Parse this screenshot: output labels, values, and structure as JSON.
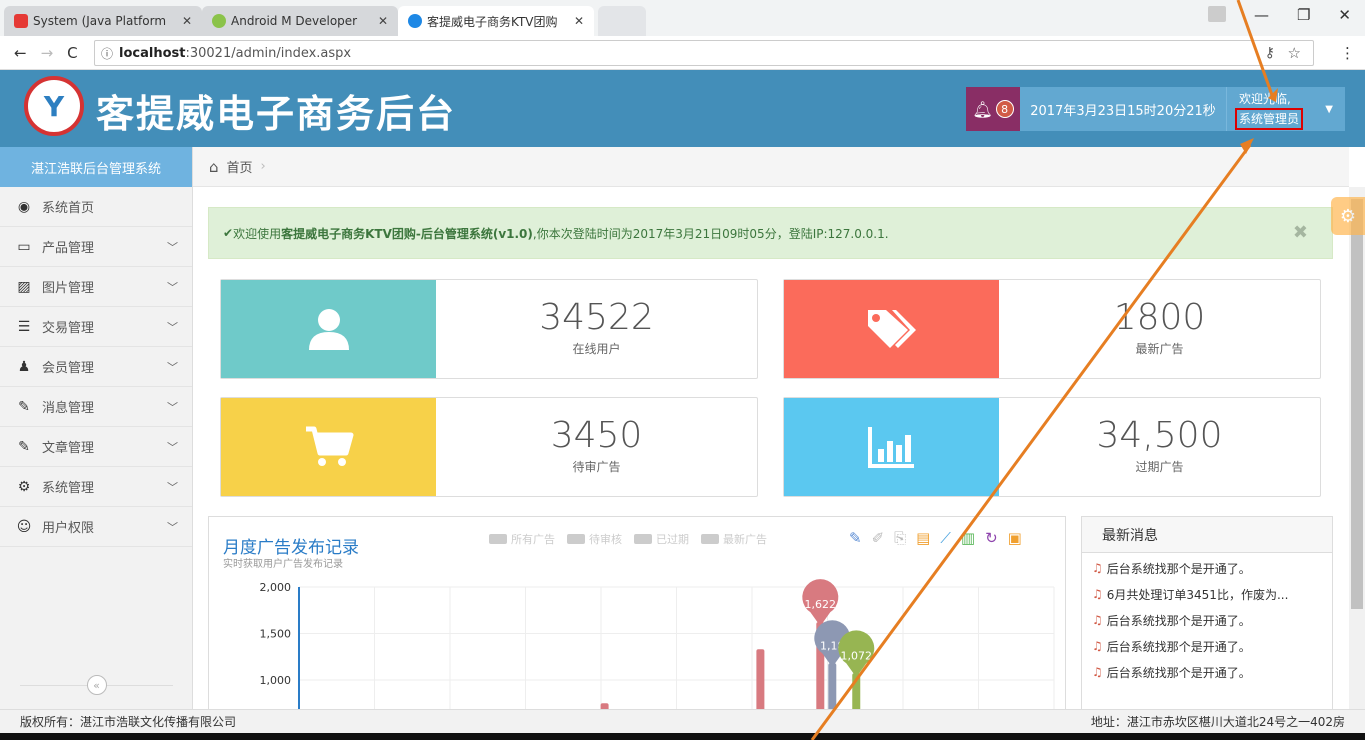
{
  "browser": {
    "tabs": [
      {
        "label": "System (Java Platform",
        "color": "#e53935"
      },
      {
        "label": "Android M Developer",
        "color": "#8bc34a"
      },
      {
        "label": "客提威电子商务KTV团购",
        "color": "#1e88e5"
      }
    ],
    "url_host": "localhost",
    "url_rest": ":30021/admin/index.aspx",
    "controls": {
      "min": "—",
      "max": "❐",
      "close": "✕"
    }
  },
  "header": {
    "title": "客提威电子商务后台",
    "notification_count": "8",
    "datetime": "2017年3月23日15时20分21秒",
    "welcome": "欢迎光临,",
    "user_role": "系统管理员"
  },
  "sidebar": {
    "heading": "湛江浩联后台管理系统",
    "items": [
      {
        "label": "系统首页",
        "icon": "dashboard-icon",
        "glyph": "◉",
        "chevron": false
      },
      {
        "label": "产品管理",
        "icon": "monitor-icon",
        "glyph": "▭",
        "chevron": true
      },
      {
        "label": "图片管理",
        "icon": "picture-icon",
        "glyph": "▨",
        "chevron": true
      },
      {
        "label": "交易管理",
        "icon": "list-icon",
        "glyph": "☰",
        "chevron": true
      },
      {
        "label": "会员管理",
        "icon": "user-icon",
        "glyph": "♟",
        "chevron": true
      },
      {
        "label": "消息管理",
        "icon": "edit-icon",
        "glyph": "✎",
        "chevron": true
      },
      {
        "label": "文章管理",
        "icon": "edit-icon",
        "glyph": "✎",
        "chevron": true
      },
      {
        "label": "系统管理",
        "icon": "cogs-icon",
        "glyph": "⚙",
        "chevron": true
      },
      {
        "label": "用户权限",
        "icon": "users-icon",
        "glyph": "☺",
        "chevron": true
      }
    ],
    "collapse_glyph": "«"
  },
  "breadcrumb": {
    "home_label": "首页",
    "sep": "›"
  },
  "alert": {
    "check": "✔",
    "prefix": "欢迎使用",
    "strong": "客提威电子商务KTV团购-后台管理系统(v1.0)",
    "suffix": ",你本次登陆时间为2017年3月21日09时05分，登陆IP:127.0.0.1.",
    "close": "✖"
  },
  "stats": [
    {
      "value": "34522",
      "label": "在线用户",
      "color": "#6fcac9",
      "icon": "user-icon"
    },
    {
      "value": "1800",
      "label": "最新广告",
      "color": "#fb6b5b",
      "icon": "tags-icon"
    },
    {
      "value": "3450",
      "label": "待审广告",
      "color": "#f7d149",
      "icon": "cart-icon"
    },
    {
      "value": "34,500",
      "label": "过期广告",
      "color": "#5bc8f0",
      "icon": "bar-chart-icon"
    }
  ],
  "chart_data": {
    "type": "bar",
    "title": "月度广告发布记录",
    "subtitle": "实时获取用户广告发布记录",
    "legend": [
      "所有广告",
      "待审核",
      "已过期",
      "最新广告"
    ],
    "ylim": [
      0,
      2000
    ],
    "yticks": [
      2000,
      1500,
      1000
    ],
    "ytick_labels": [
      "2,000",
      "1,500",
      "1,000"
    ],
    "series": [
      {
        "name": "所有广告",
        "color": "#d87a80",
        "values": [
          0,
          0,
          0,
          0,
          0,
          0,
          0,
          0,
          0,
          0,
          0,
          0,
          0,
          0,
          0,
          0,
          0,
          0,
          0,
          0,
          0,
          0,
          0,
          0,
          0,
          750,
          0,
          0,
          0,
          0,
          0,
          0,
          0,
          0,
          0,
          0,
          0,
          0,
          1330,
          0,
          0,
          0,
          0,
          1622,
          0,
          0,
          0,
          0,
          0,
          0,
          0,
          0,
          0,
          0,
          0,
          0,
          0,
          0,
          0,
          0,
          0,
          0,
          0
        ]
      },
      {
        "name": "待审核",
        "color": "#8d98b3",
        "values": [
          0,
          0,
          0,
          0,
          0,
          0,
          0,
          0,
          0,
          0,
          0,
          0,
          0,
          0,
          0,
          0,
          0,
          0,
          0,
          0,
          0,
          0,
          0,
          0,
          0,
          0,
          0,
          0,
          0,
          0,
          0,
          0,
          0,
          0,
          0,
          0,
          0,
          0,
          0,
          0,
          0,
          0,
          0,
          0,
          1180,
          0,
          0,
          0,
          0,
          0,
          0,
          0,
          0,
          0,
          0,
          0,
          0,
          0,
          0,
          0,
          0,
          0,
          0
        ]
      },
      {
        "name": "最新广告",
        "color": "#97b552",
        "values": [
          0,
          0,
          0,
          0,
          0,
          0,
          0,
          0,
          0,
          0,
          0,
          0,
          0,
          0,
          0,
          0,
          0,
          0,
          0,
          0,
          0,
          0,
          0,
          0,
          0,
          0,
          0,
          0,
          0,
          0,
          0,
          0,
          0,
          0,
          0,
          0,
          0,
          0,
          0,
          0,
          0,
          0,
          0,
          0,
          0,
          0,
          1072,
          0,
          0,
          0,
          0,
          0,
          0,
          0,
          0,
          0,
          0,
          0,
          0,
          0,
          0,
          0,
          0
        ]
      }
    ],
    "pins": [
      {
        "label": "1,622",
        "series": 0,
        "index": 43,
        "color": "#d87a80"
      },
      {
        "label": "1,18",
        "series": 1,
        "index": 44,
        "color": "#8d98b3"
      },
      {
        "label": "1,072",
        "series": 2,
        "index": 46,
        "color": "#97b552"
      }
    ],
    "toolbox_icons": [
      "✎",
      "✐",
      "⎘",
      "▤",
      "⟋",
      "▥",
      "↻",
      "▣"
    ]
  },
  "news": {
    "heading": "最新消息",
    "items": [
      "后台系统找那个是开通了。",
      "6月共处理订单3451比，作废为...",
      "后台系统找那个是开通了。",
      "后台系统找那个是开通了。",
      "后台系统找那个是开通了。"
    ]
  },
  "footer": {
    "left": "版权所有：湛江市浩联文化传播有限公司",
    "right": "地址：湛江市赤坎区椹川大道北24号之一402房"
  }
}
